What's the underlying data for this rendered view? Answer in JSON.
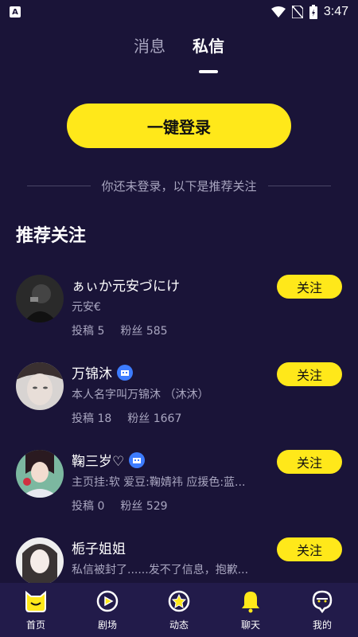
{
  "status_bar": {
    "time": "3:47",
    "app_badge": "A"
  },
  "tabs": [
    {
      "label": "消息",
      "active": false
    },
    {
      "label": "私信",
      "active": true
    }
  ],
  "login_button": "一键登录",
  "hint": "你还未登录，以下是推荐关注",
  "section_title": "推荐关注",
  "users": [
    {
      "name": "ぁぃか元安づにけ",
      "verified": false,
      "bio": "元安€",
      "posts_label": "投稿",
      "posts": "5",
      "fans_label": "粉丝",
      "fans": "585",
      "follow_label": "关注"
    },
    {
      "name": "万锦沐",
      "verified": true,
      "bio": "本人名字叫万锦沐 （沐沐）",
      "posts_label": "投稿",
      "posts": "18",
      "fans_label": "粉丝",
      "fans": "1667",
      "follow_label": "关注"
    },
    {
      "name": "鞠三岁♡",
      "verified": true,
      "bio": "主页挂:软 爱豆:鞠婧祎 应援色:蓝...",
      "posts_label": "投稿",
      "posts": "0",
      "fans_label": "粉丝",
      "fans": "529",
      "follow_label": "关注"
    },
    {
      "name": "栀子姐姐",
      "verified": false,
      "bio": "私信被封了......发不了信息，抱歉...",
      "follow_label": "关注"
    }
  ],
  "bottom_nav": [
    {
      "label": "首页",
      "icon": "home-cat-icon"
    },
    {
      "label": "剧场",
      "icon": "play-icon"
    },
    {
      "label": "动态",
      "icon": "star-icon"
    },
    {
      "label": "聊天",
      "icon": "bell-icon"
    },
    {
      "label": "我的",
      "icon": "profile-face-icon"
    }
  ],
  "colors": {
    "background": "#1a1438",
    "nav_background": "#221b4a",
    "accent_yellow": "#ffe81a",
    "muted_text": "#a9a6c0",
    "verify_blue": "#3d7cff"
  }
}
